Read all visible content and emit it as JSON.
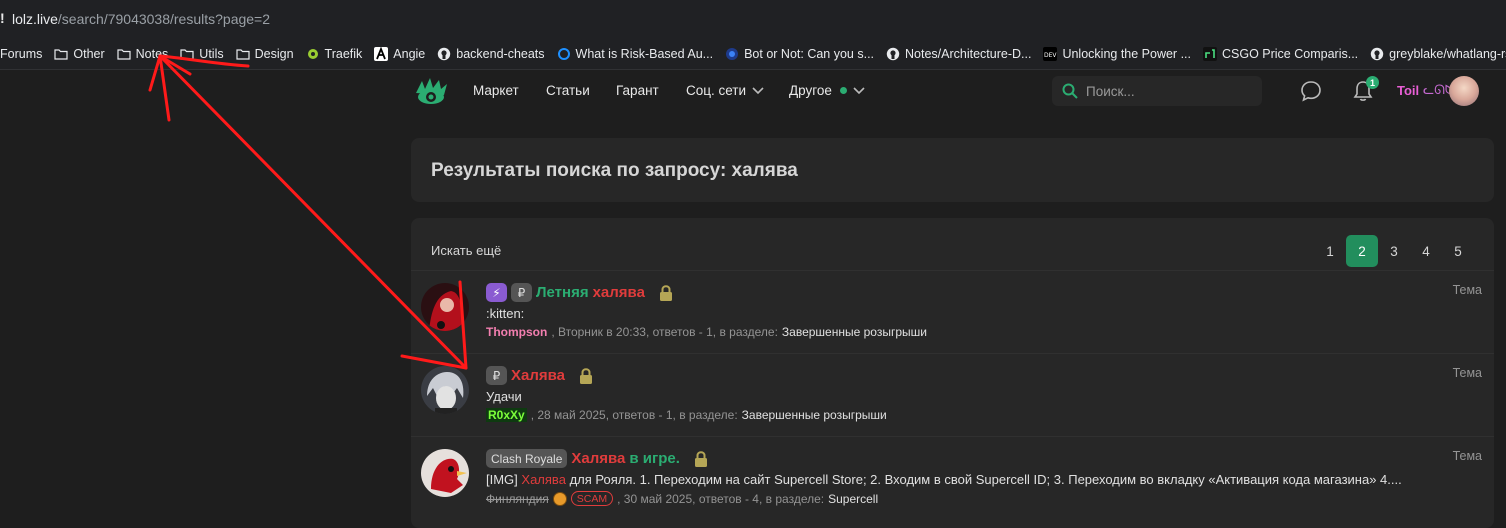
{
  "browser": {
    "url_domain": "lolz.live",
    "url_path": "/search/79043038/results?page=2",
    "bookmarks": [
      {
        "label": "Forums",
        "icon": "folder-icon"
      },
      {
        "label": "Other",
        "icon": "folder-icon"
      },
      {
        "label": "Notes",
        "icon": "folder-icon"
      },
      {
        "label": "Utils",
        "icon": "folder-icon"
      },
      {
        "label": "Design",
        "icon": "folder-icon"
      },
      {
        "label": "Traefik",
        "icon": "traefik-icon"
      },
      {
        "label": "Angie",
        "icon": "angie-icon"
      },
      {
        "label": "backend-cheats",
        "icon": "github-icon"
      },
      {
        "label": "What is Risk-Based Au...",
        "icon": "circle-icon"
      },
      {
        "label": "Bot or Not: Can you s...",
        "icon": "globe-icon"
      },
      {
        "label": "Notes/Architecture-D...",
        "icon": "github-icon"
      },
      {
        "label": "Unlocking the Power ...",
        "icon": "dev-icon"
      },
      {
        "label": "CSGO Price Comparis...",
        "icon": "csgo-icon"
      },
      {
        "label": "greyblake/whatlang-rs...",
        "icon": "github-icon"
      }
    ]
  },
  "header": {
    "nav": [
      {
        "label": "Маркет"
      },
      {
        "label": "Статьи"
      },
      {
        "label": "Гарант"
      },
      {
        "label": "Соц. сети"
      },
      {
        "label": "Другое"
      }
    ],
    "search_placeholder": "Поиск...",
    "notification_count": "1",
    "username": "Toil",
    "user_emoji": "ᓚᘏᗢ"
  },
  "search": {
    "title": "Результаты поиска по запросу: халява",
    "search_more": "Искать ещё",
    "pages": [
      "1",
      "2",
      "3",
      "4",
      "5"
    ],
    "current_page": "2"
  },
  "results": [
    {
      "prefixes": [
        "⚡",
        "₽"
      ],
      "title_parts": [
        {
          "text": "Летняя",
          "color": "green"
        },
        {
          "text": "халява",
          "color": "red"
        }
      ],
      "snippet": ":kitten:",
      "author": "Thompson",
      "meta": ", Вторник в 20:33, ответов - 1, в разделе:",
      "section": "Завершенные розыгрыши",
      "type": "Тема"
    },
    {
      "prefixes": [
        "₽"
      ],
      "title_parts": [
        {
          "text": "Халява",
          "color": "red"
        }
      ],
      "snippet": "Удачи",
      "author": "R0xXy",
      "meta": ", 28 май 2025, ответов - 1, в разделе:",
      "section": "Завершенные розыгрыши",
      "type": "Тема"
    },
    {
      "prefixes": [
        "Clash Royale"
      ],
      "title_parts": [
        {
          "text": "Халява",
          "color": "red"
        },
        {
          "text": "в игре.",
          "color": "green"
        }
      ],
      "snippet_prefix": "[IMG]",
      "snippet_highlight": "Халява",
      "snippet": "для Рояля. 1. Переходим на сайт Supercell Store; 2. Входим в свой Supercell ID; 3. Переходим во вкладку «Активация кода магазина» 4....",
      "author": "Финляндия",
      "badge": "SCAM",
      "meta": ", 30 май 2025, ответов - 4, в разделе:",
      "section": "Supercell",
      "type": "Тема"
    }
  ],
  "colors": {
    "accent": "#228e5d",
    "title_green": "#2bad72",
    "title_red": "#e03c3c",
    "background": "#1e1e1e",
    "panel": "#272727",
    "annotation": "#ff1a1a"
  }
}
